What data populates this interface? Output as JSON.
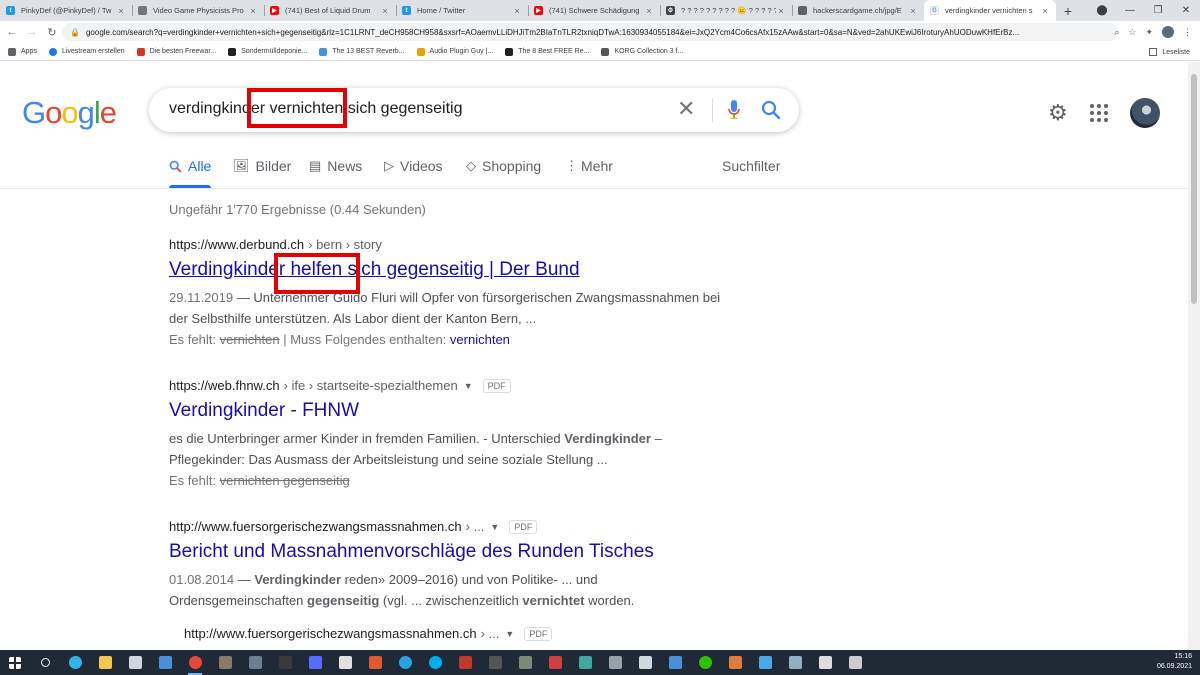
{
  "browser": {
    "tabs": [
      {
        "title": "PinkyDef (@PinkyDef) / Tw",
        "favicon_color": "#1d9bf0",
        "favicon": "twitter-icon"
      },
      {
        "title": "Video Game Physicists Pro",
        "favicon_color": "#777777",
        "favicon": "page-icon"
      },
      {
        "title": "(741) Best of Liquid Drum",
        "favicon_color": "#ff0000",
        "favicon": "youtube-icon"
      },
      {
        "title": "Home / Twitter",
        "favicon_color": "#1d9bf0",
        "favicon": "twitter-icon"
      },
      {
        "title": "(741) Schwere Schädigung",
        "favicon_color": "#ff0000",
        "favicon": "youtube-icon"
      },
      {
        "title": "? ? ? ? ? ? ? ? ? 😐 ? ? ? ? ? ?",
        "favicon_color": "#444444",
        "favicon": "gear-icon"
      },
      {
        "title": "hackerscardgame.ch/jpg/E",
        "favicon_color": "#5f6368",
        "favicon": "globe-icon"
      },
      {
        "title": "verdingkinder vernichten s",
        "favicon_color": "#4285f4",
        "favicon": "google-icon",
        "active": true
      }
    ],
    "url": "google.com/search?q=verdingkinder+vernichten+sich+gegenseitig&rlz=1C1LRNT_deCH958CH958&sxsrf=AOaemvLLiDHJiTm2BIaTnTLR2txniqDTwA:1630934055184&ei=JxQ2Ycm4Co6csAfx15zAAw&start=0&sa=N&ved=2ahUKEwiJ6IroturyAhUODuwKHfErBz...",
    "bookmarks": [
      {
        "label": "Apps",
        "color": "#5f6368"
      },
      {
        "label": "Livestream erstellen",
        "color": "#1877f2"
      },
      {
        "label": "Die besten Freewar...",
        "color": "#d93025"
      },
      {
        "label": "Sondermülldeponie...",
        "color": "#202124"
      },
      {
        "label": "The 13 BEST Reverb...",
        "color": "#4a90d9"
      },
      {
        "label": "Audio Plugin Guy |...",
        "color": "#e0a800"
      },
      {
        "label": "The 8 Best FREE Re...",
        "color": "#202124"
      },
      {
        "label": "KORG Collection 3 f...",
        "color": "#555555"
      }
    ],
    "reading_list": "Leseliste"
  },
  "google": {
    "logo": "Google",
    "query": "verdingkinder vernichten sich gegenseitig",
    "tabs": [
      {
        "label": "Alle",
        "icon": "search-icon",
        "active": true
      },
      {
        "label": "Bilder",
        "icon": "image-icon"
      },
      {
        "label": "News",
        "icon": "news-icon"
      },
      {
        "label": "Videos",
        "icon": "video-icon"
      },
      {
        "label": "Shopping",
        "icon": "tag-icon"
      },
      {
        "label": "Mehr",
        "icon": "more-vert-icon"
      }
    ],
    "filter_label": "Suchfilter",
    "stats": "Ungefähr 1'770 Ergebnisse (0.44 Sekunden)"
  },
  "results": [
    {
      "cite": "https://www.derbund.ch",
      "path": "› bern › story",
      "title": "Verdingkinder helfen sich gegenseitig | Der Bund",
      "date": "29.11.2019",
      "snippet_line1": "Unternehmer Guido Fluri will Opfer von fürsorgerischen Zwangsmassnahmen bei",
      "snippet_line2": "der Selbsthilfe unterstützen. Als Labor dient der Kanton Bern, ...",
      "missing_label": "Es fehlt:",
      "missing_word": "vernichten",
      "must_label": "| Muss Folgendes enthalten:",
      "must_word": "vernichten"
    },
    {
      "cite": "https://web.fhnw.ch",
      "path": "› ife › startseite-spezialthemen",
      "badge": "PDF",
      "title": "Verdingkinder - FHNW",
      "snippet_a": "es die Unterbringer armer Kinder in fremden Familien. - Unterschied",
      "snippet_b": "Verdingkinder",
      "snippet_c": "–",
      "snippet_line2": "Pflegekinder: Das Ausmass der Arbeitsleistung und seine soziale Stellung ...",
      "missing_label": "Es fehlt:",
      "missing_word": "vernichten gegenseitig"
    },
    {
      "cite": "http://www.fuersorgerischezwangsmassnahmen.ch",
      "path": "› ...",
      "badge": "PDF",
      "title": "Bericht und Massnahmenvorschläge des Runden Tisches",
      "date": "01.08.2014",
      "s1a": "Verdingkinder",
      "s1b": "reden» 2009–2016) und von Politike- ... und",
      "s2a": "Ordensgemeinschaften",
      "s2b": "gegenseitig",
      "s2c": "(vgl. ... zwischenzeitlich",
      "s2d": "vernichtet",
      "s2e": "worden."
    },
    {
      "cite": "http://www.fuersorgerischezwangsmassnahmen.ch",
      "path": "› ...",
      "badge": "PDF"
    }
  ],
  "taskbar": {
    "time": "15:16",
    "date": "06.09.2021",
    "icons": [
      {
        "name": "start-icon",
        "color": "#ffffff"
      },
      {
        "name": "search-icon",
        "color": "#ffffff"
      },
      {
        "name": "edge-icon",
        "color": "#2fb5e8"
      },
      {
        "name": "explorer-icon",
        "color": "#f2c94c"
      },
      {
        "name": "store-icon",
        "color": "#d0d6de"
      },
      {
        "name": "mail-icon",
        "color": "#4a90d9"
      },
      {
        "name": "chrome-icon",
        "color": "#e8453c"
      },
      {
        "name": "app-icon",
        "color": "#8a7a6a"
      },
      {
        "name": "app-icon",
        "color": "#6a7f8f"
      },
      {
        "name": "app-icon",
        "color": "#3a3a3a"
      },
      {
        "name": "app-icon",
        "color": "#5a6cff"
      },
      {
        "name": "app-icon",
        "color": "#e0e0e0"
      },
      {
        "name": "app-icon",
        "color": "#e05a2b"
      },
      {
        "name": "telegram-icon",
        "color": "#2aa3df"
      },
      {
        "name": "skype-icon",
        "color": "#00aff0"
      },
      {
        "name": "app-icon",
        "color": "#c0392b"
      },
      {
        "name": "app-icon",
        "color": "#555555"
      },
      {
        "name": "app-icon",
        "color": "#7a8a7a"
      },
      {
        "name": "app-icon",
        "color": "#d04040"
      },
      {
        "name": "app-icon",
        "color": "#3fa9a0"
      },
      {
        "name": "app-icon",
        "color": "#9aa0a6"
      },
      {
        "name": "app-icon",
        "color": "#cfd8dc"
      },
      {
        "name": "app-icon",
        "color": "#4a90d9"
      },
      {
        "name": "wechat-icon",
        "color": "#2dc100"
      },
      {
        "name": "app-icon",
        "color": "#e07b3c"
      },
      {
        "name": "app-icon",
        "color": "#4aa8e8"
      },
      {
        "name": "app-icon",
        "color": "#8fb0c0"
      },
      {
        "name": "app-icon",
        "color": "#dddddd"
      },
      {
        "name": "terminal-icon",
        "color": "#cccccc"
      }
    ]
  },
  "colors": {
    "link": "#1a0dab",
    "accent": "#1a73e8",
    "highlight_box": "#e80000"
  }
}
